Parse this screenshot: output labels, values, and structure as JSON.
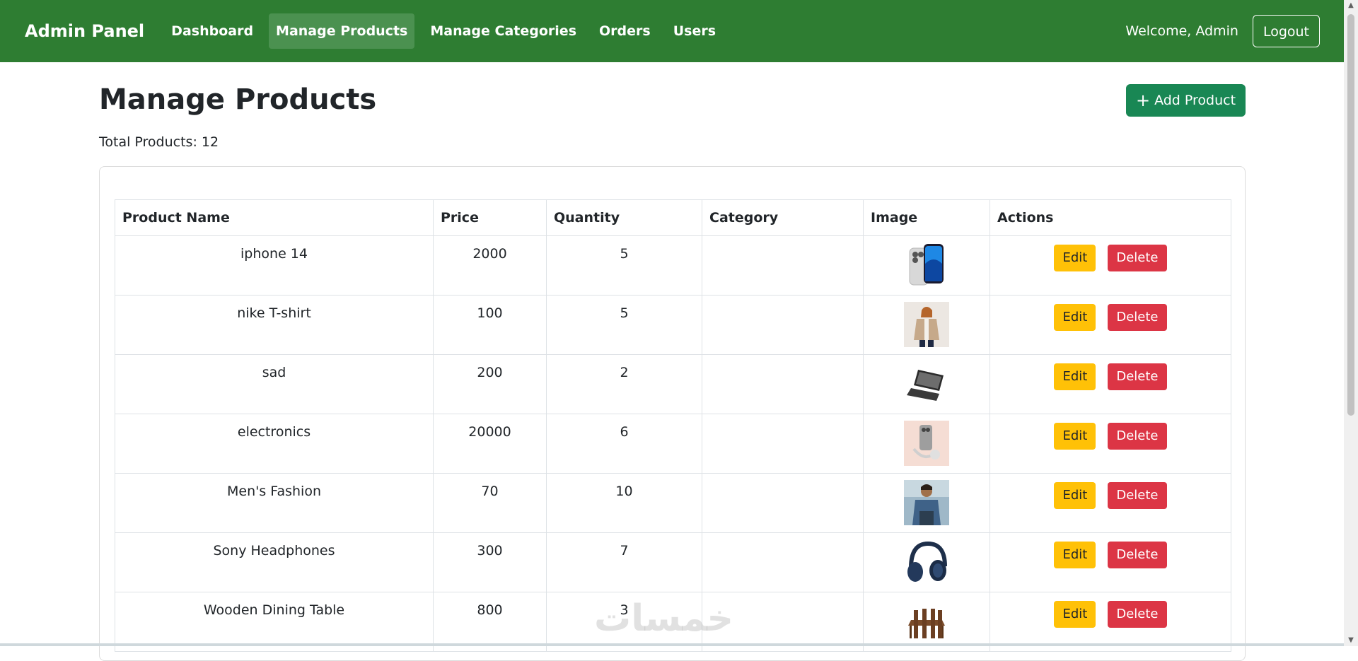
{
  "navbar": {
    "brand": "Admin Panel",
    "links": [
      {
        "label": "Dashboard",
        "active": false
      },
      {
        "label": "Manage Products",
        "active": true
      },
      {
        "label": "Manage Categories",
        "active": false
      },
      {
        "label": "Orders",
        "active": false
      },
      {
        "label": "Users",
        "active": false
      }
    ],
    "welcome": "Welcome, Admin",
    "logout_label": "Logout",
    "color": "#2e7d32"
  },
  "page": {
    "title": "Manage Products",
    "add_button_label": "Add Product",
    "add_button_icon": "plus-icon",
    "total_text": "Total Products: 12"
  },
  "table": {
    "headers": [
      "Product Name",
      "Price",
      "Quantity",
      "Category",
      "Image",
      "Actions"
    ],
    "rows": [
      {
        "name": "iphone 14",
        "price": "2000",
        "quantity": "5",
        "category": "",
        "image": "phone-image"
      },
      {
        "name": "nike T-shirt",
        "price": "100",
        "quantity": "5",
        "category": "",
        "image": "jacket-woman-image"
      },
      {
        "name": "sad",
        "price": "200",
        "quantity": "2",
        "category": "",
        "image": "laptop-image"
      },
      {
        "name": "electronics",
        "price": "20000",
        "quantity": "6",
        "category": "",
        "image": "phone-accessories-image"
      },
      {
        "name": "Men's Fashion",
        "price": "70",
        "quantity": "10",
        "category": "",
        "image": "man-fashion-image"
      },
      {
        "name": "Sony Headphones",
        "price": "300",
        "quantity": "7",
        "category": "",
        "image": "headphones-image"
      },
      {
        "name": "Wooden Dining Table",
        "price": "800",
        "quantity": "3",
        "category": "",
        "image": "dining-table-image"
      }
    ],
    "edit_label": "Edit",
    "delete_label": "Delete"
  },
  "watermark": "خمسات",
  "colors": {
    "success": "#198754",
    "warning": "#ffc107",
    "danger": "#dc3545"
  }
}
